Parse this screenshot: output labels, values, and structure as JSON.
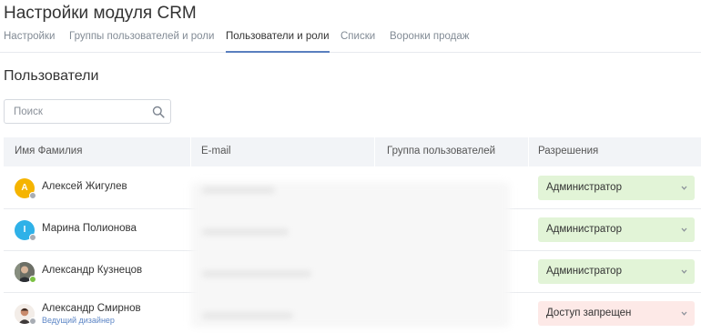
{
  "header": {
    "title": "Настройки модуля CRM",
    "tabs": [
      {
        "label": "Настройки"
      },
      {
        "label": "Группы пользователей и роли"
      },
      {
        "label": "Пользователи и роли"
      },
      {
        "label": "Списки"
      },
      {
        "label": "Воронки продаж"
      }
    ],
    "active_tab": "Пользователи и роли"
  },
  "main": {
    "section_title": "Пользователи",
    "search": {
      "placeholder": "Поиск",
      "value": ""
    },
    "table": {
      "columns": [
        "Имя Фамилия",
        "E-mail",
        "Группа пользователей",
        "Разрешения"
      ],
      "rows": [
        {
          "avatar_initial": "А",
          "avatar_color": "#f5b400",
          "status": "offline",
          "name": "Алексей Жигулев",
          "role": "",
          "permission": "Администратор",
          "permission_tone": "green"
        },
        {
          "avatar_initial": "I",
          "avatar_color": "#2fb1e8",
          "status": "offline",
          "name": "Марина Полионова",
          "role": "",
          "permission": "Администратор",
          "permission_tone": "green"
        },
        {
          "avatar_initial": "",
          "avatar_color": "#5b5f57",
          "status": "online",
          "name": "Александр Кузнецов",
          "role": "",
          "permission": "Администратор",
          "permission_tone": "green"
        },
        {
          "avatar_initial": "",
          "avatar_color": "#c98a6b",
          "status": "offline",
          "name": "Александр Смирнов",
          "role": "Ведущий дизайнер",
          "permission": "Доступ запрещен",
          "permission_tone": "red"
        }
      ]
    }
  },
  "colors": {
    "accent": "#5a7fbf",
    "permission_green": "#e2f4d7",
    "permission_red": "#fde9e7",
    "role_link": "#5d86c6"
  }
}
